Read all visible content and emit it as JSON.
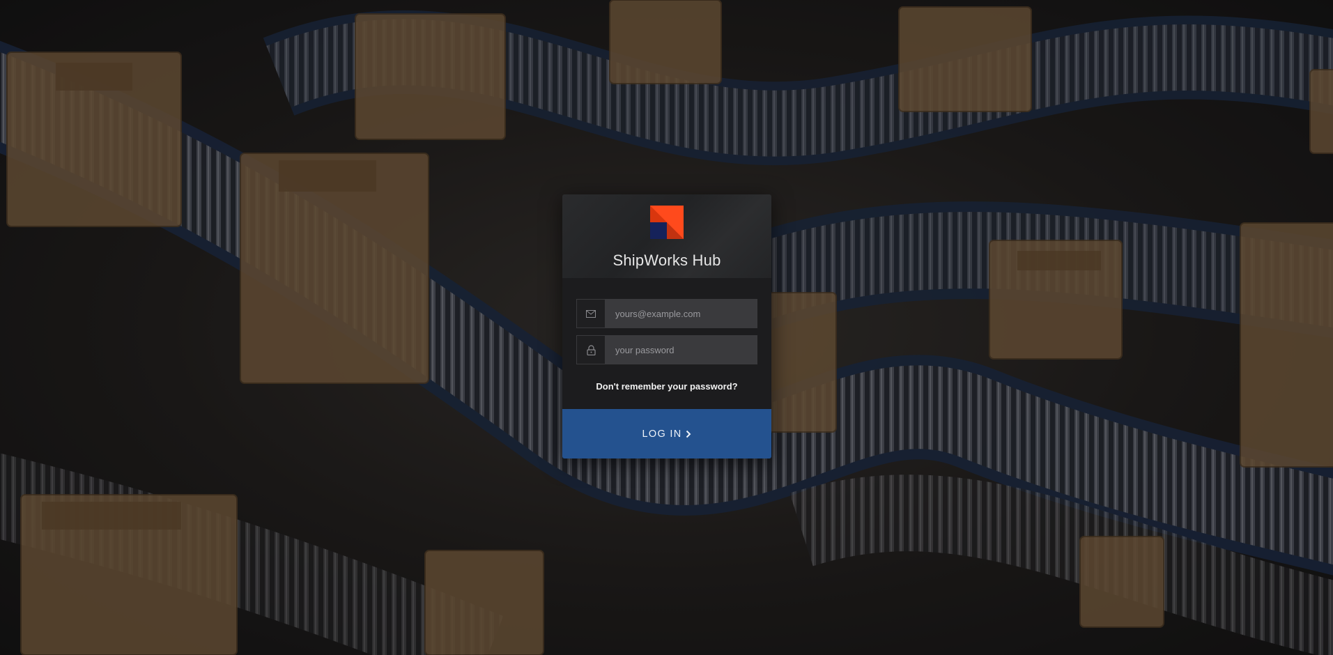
{
  "app": {
    "brand_name": "ShipWorks Hub"
  },
  "login": {
    "email_placeholder": "yours@example.com",
    "password_placeholder": "your password",
    "forgot_label": "Don't remember your password?",
    "submit_label": "LOG IN"
  },
  "icons": {
    "logo": "shipworks-logo-icon",
    "email": "envelope-icon",
    "password": "lock-icon",
    "submit": "chevron-right-icon"
  },
  "colors": {
    "logo_orange": "#ff4a1c",
    "logo_navy": "#15225a",
    "submit_bg": "#24528f",
    "card_bg": "#1c1c1e"
  }
}
